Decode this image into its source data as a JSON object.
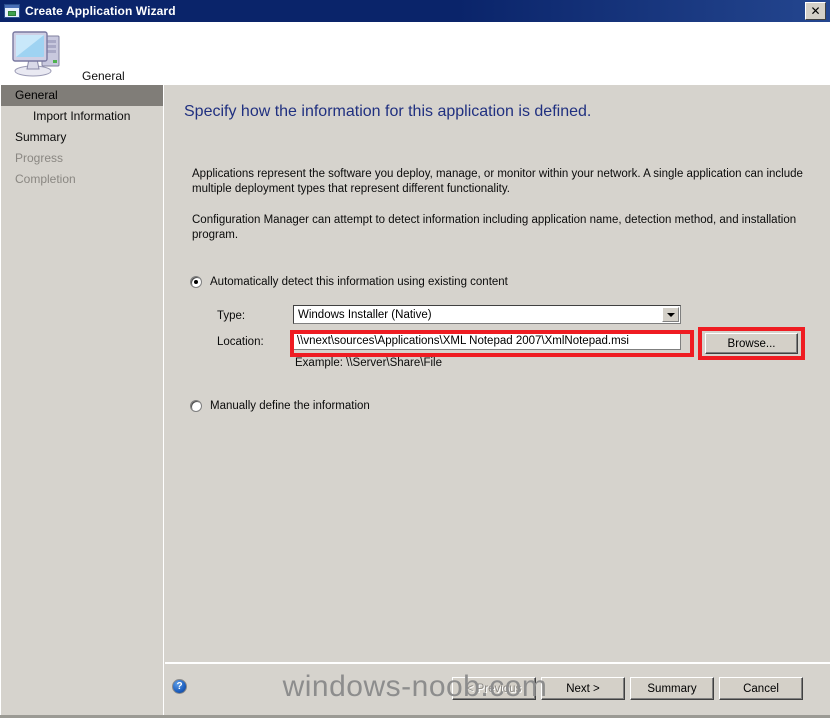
{
  "window": {
    "title": "Create Application Wizard",
    "title_icon": "wizard-window-icon",
    "close_label": "✕",
    "header_caption": "General",
    "header_icon": "computer-monitor-icon"
  },
  "sidebar": {
    "items": [
      {
        "label": "General",
        "state": "selected",
        "sub": false
      },
      {
        "label": "Import Information",
        "state": "normal",
        "sub": true
      },
      {
        "label": "Summary",
        "state": "normal",
        "sub": false
      },
      {
        "label": "Progress",
        "state": "disabled",
        "sub": false
      },
      {
        "label": "Completion",
        "state": "disabled",
        "sub": false
      }
    ]
  },
  "main": {
    "heading": "Specify how the information for this application is defined.",
    "paragraph_1": "Applications represent the software you deploy, manage, or monitor within your network. A single application can include multiple deployment types that represent different functionality.",
    "paragraph_2": "Configuration Manager can attempt to detect information including application name, detection method, and installation program.",
    "radio_auto": {
      "label": "Automatically detect this information using existing content",
      "checked": true
    },
    "radio_manual": {
      "label": "Manually define the information",
      "checked": false
    },
    "type_field": {
      "label": "Type:",
      "value": "Windows Installer (Native)",
      "arrow_icon": "chevron-down-icon"
    },
    "location_field": {
      "label": "Location:",
      "value": "\\\\vnext\\sources\\Applications\\XML Notepad 2007\\XmlNotepad.msi",
      "placeholder": ""
    },
    "location_example": "Example: \\\\Server\\Share\\File",
    "browse_button": "Browse..."
  },
  "footer": {
    "help_icon": "help-question-icon",
    "help_label": "?",
    "buttons": [
      {
        "label": "< Previous",
        "disabled": true
      },
      {
        "label": "Next >",
        "disabled": false
      },
      {
        "label": "Summary",
        "disabled": false
      },
      {
        "label": "Cancel",
        "disabled": false
      }
    ]
  },
  "annotations": {
    "highlight_color": "#ef1c22",
    "boxes": [
      {
        "target": "location-input"
      },
      {
        "target": "browse-button"
      }
    ]
  },
  "watermark": {
    "text": "windows-noob.com"
  }
}
